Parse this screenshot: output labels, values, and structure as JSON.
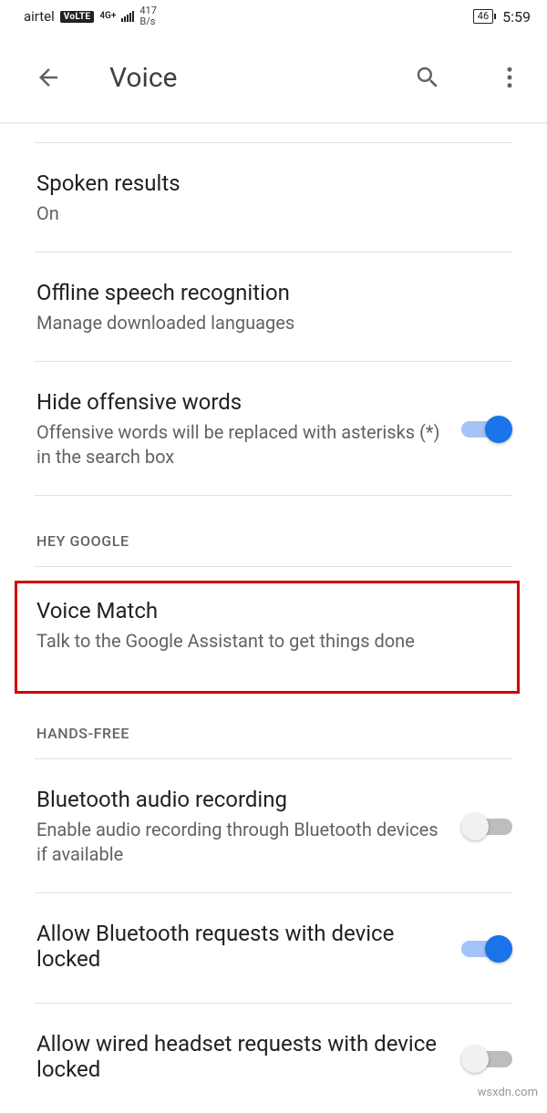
{
  "status": {
    "carrier": "airtel",
    "badge": "VoLTE",
    "net_top": "4G+",
    "speed_top": "417",
    "speed_bottom": "B/s",
    "battery": "46",
    "clock": "5:59"
  },
  "appbar": {
    "title": "Voice"
  },
  "items": {
    "spoken_results": {
      "title": "Spoken results",
      "subtitle": "On"
    },
    "offline": {
      "title": "Offline speech recognition",
      "subtitle": "Manage downloaded languages"
    },
    "offensive": {
      "title": "Hide offensive words",
      "subtitle": "Offensive words will be replaced with asterisks (*) in the search box"
    },
    "voice_match": {
      "title": "Voice Match",
      "subtitle": "Talk to the Google Assistant to get things done"
    },
    "bt_audio": {
      "title": "Bluetooth audio recording",
      "subtitle": "Enable audio recording through Bluetooth devices if available"
    },
    "bt_locked": {
      "title": "Allow Bluetooth requests with device locked"
    },
    "wired_locked": {
      "title": "Allow wired headset requests with device locked"
    }
  },
  "sections": {
    "hey_google": "HEY GOOGLE",
    "hands_free": "HANDS-FREE"
  },
  "watermark": "wsxdn.com"
}
